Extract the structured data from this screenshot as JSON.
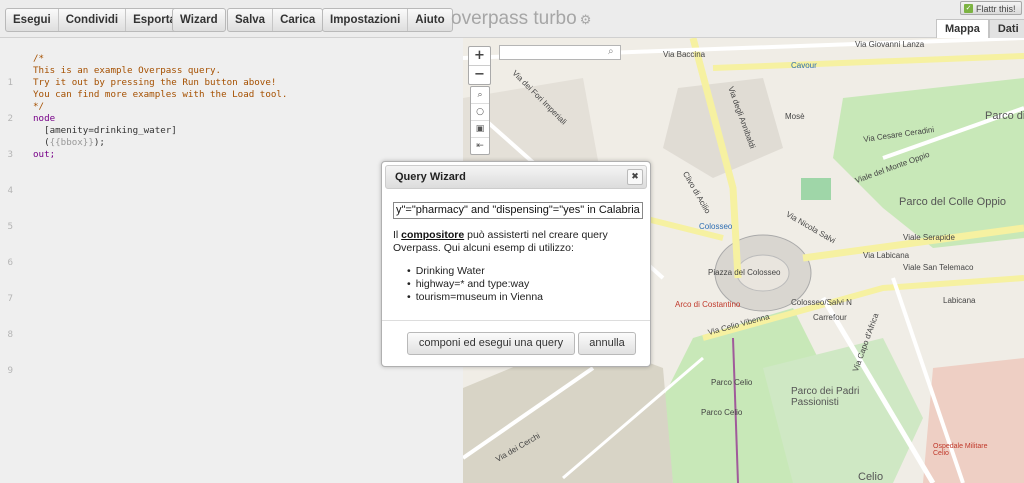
{
  "toolbar": {
    "run": "Esegui",
    "share": "Condividi",
    "export": "Esporta",
    "wizard": "Wizard",
    "save": "Salva",
    "load": "Carica",
    "settings": "Impostazioni",
    "help": "Aiuto"
  },
  "app": {
    "title": "overpass turbo"
  },
  "flattr": {
    "label": "Flattr this!"
  },
  "view_tabs": {
    "map": "Mappa",
    "data": "Dati"
  },
  "editor": {
    "line_numbers": [
      "1",
      "2",
      "3",
      "4",
      "5",
      "6",
      "7",
      "8",
      "9"
    ],
    "lines": {
      "l1": "/*",
      "l2": "This is an example Overpass query.",
      "l3": "Try it out by pressing the Run button above!",
      "l4": "You can find more examples with the Load tool.",
      "l5": "*/",
      "l6": "node",
      "l7": "  [amenity=drinking_water]",
      "l8a": "  (",
      "l8b": "{{bbox}}",
      "l8c": ");",
      "l9": "out;"
    }
  },
  "map": {
    "zoom_in": "+",
    "zoom_out": "−",
    "labels": {
      "cavour": "Cavour",
      "via_giovanni_lanza": "Via Giovanni Lanza",
      "via_baccina": "Via Baccina",
      "via_degli_annibaldi": "Via degli Annibaldi",
      "via_dei_fori_imperiali": "Via dei Fori Imperiali",
      "parco_di_traiano": "Parco di Traiano",
      "via_cesare_ceradini": "Via Cesare Ceradini",
      "parco_colle_oppio": "Parco del Colle Oppio",
      "viale_del_monte_oppio": "Viale del Monte Oppio",
      "viale_serapide": "Viale Serapide",
      "via_labicana": "Via Labicana",
      "viale_san_telemaco": "Viale San Telemaco",
      "colosseo": "Colosseo",
      "via_nicola_salvi": "Via Nicola Salvi",
      "piazza_del_colosseo": "Piazza del Colosseo",
      "arco_di_costantino": "Arco di Costantino",
      "colosseo_salvi": "Colosseo/Salvi N",
      "via_celio_vibenna": "Via Celio Vibenna",
      "parco_celio": "Parco Celio",
      "via_capo_d_africa": "Via Capo d'Africa",
      "via_dei_cerchi": "Via dei Cerchi",
      "parco_padri_passionisti": "Parco dei Padri Passionisti",
      "labicana": "Labicana",
      "celio": "Celio",
      "ospedale_celio": "Ospedale Militare Celio",
      "parco_celio_2": "Parco Celio",
      "carrefour": "Carrefour",
      "mose": "Mosè",
      "via_del_ciclo": "Clivo di Acilio"
    }
  },
  "dialog": {
    "title": "Query Wizard",
    "close": "✖",
    "input_value": "y\"=\"pharmacy\" and \"dispensing\"=\"yes\" in Calabria",
    "intro_1": "Il ",
    "intro_link": "compositore",
    "intro_2": " può assisterti nel creare query Overpass. Qui alcuni esemp di utilizzo:",
    "examples": [
      "Drinking Water",
      "highway=* and type:way",
      "tourism=museum in Vienna"
    ],
    "build_button": "componi ed esegui una query",
    "cancel_button": "annulla"
  },
  "colors": {
    "accent": "#7cb342",
    "comment": "#a55000",
    "keyword": "#770088",
    "park": "#c8e8b8",
    "road_yellow": "#f6f1a1"
  }
}
